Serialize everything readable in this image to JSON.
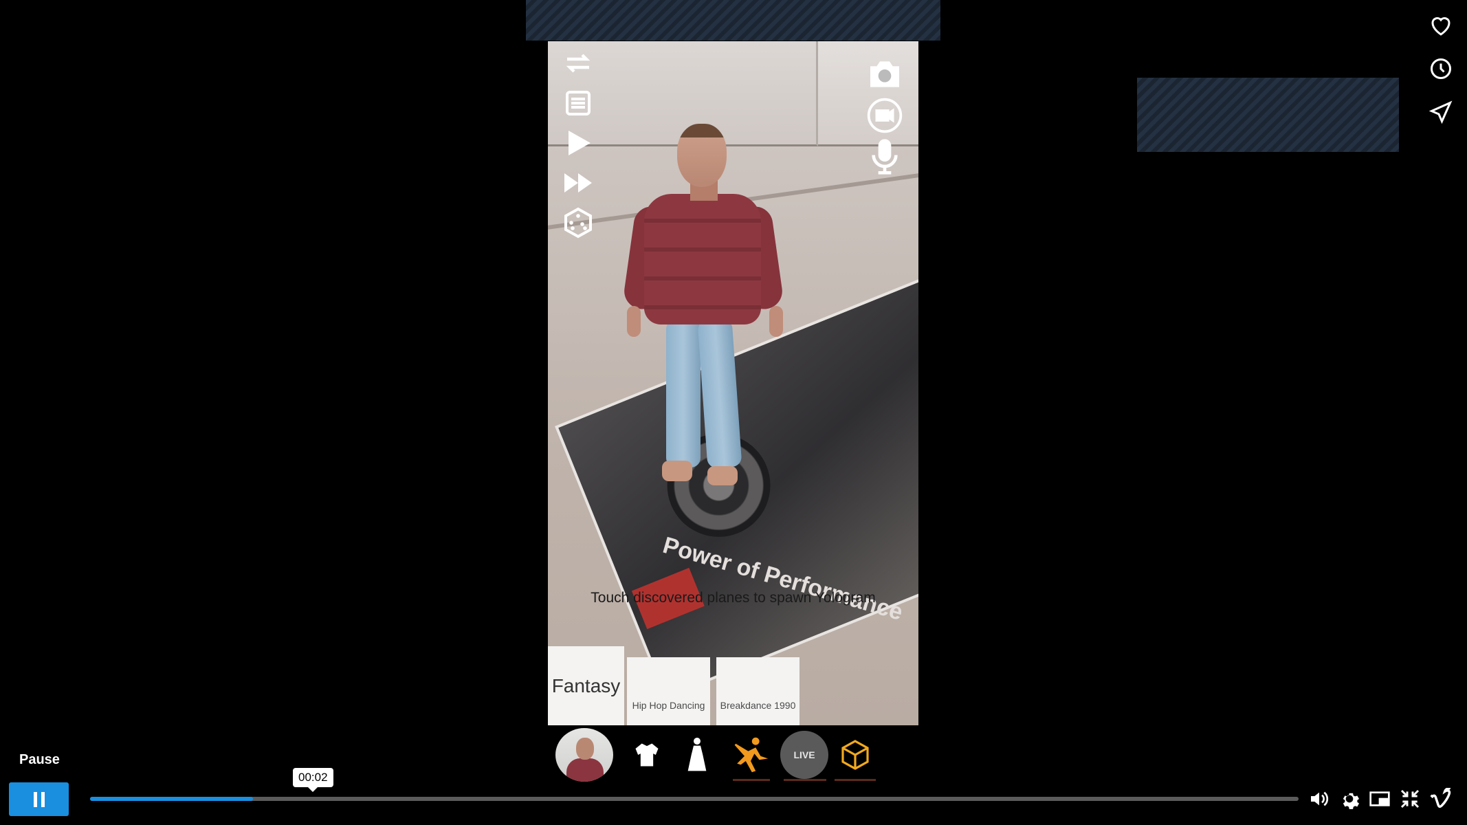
{
  "app": {
    "phone": {
      "hint": "Touch discovered planes to spawn Yologram",
      "magazine_title": "Power of Performance",
      "categories": [
        "Fantasy",
        "Hip Hop Dancing",
        "Breakdance 1990"
      ],
      "toolbar": {
        "live_label": "LIVE",
        "icons": [
          "avatar-thumbnail",
          "jacket-icon",
          "dress-icon",
          "dance-icon",
          "live-icon",
          "cube-icon"
        ]
      },
      "left_icons": [
        "repeat-icon",
        "list-icon",
        "play-icon",
        "fast-forward-icon",
        "dice-icon"
      ],
      "right_icons": [
        "camera-icon",
        "video-icon",
        "microphone-icon"
      ]
    },
    "rail_icons": [
      "heart-icon",
      "clock-icon",
      "send-icon"
    ],
    "player": {
      "tooltip": "Pause",
      "current_time": "00:02",
      "progress": 0.135,
      "accent": "#1a8fe0",
      "controls": [
        "volume-icon",
        "settings-icon",
        "pip-icon",
        "fullscreen-exit-icon",
        "vimeo-logo"
      ]
    }
  }
}
